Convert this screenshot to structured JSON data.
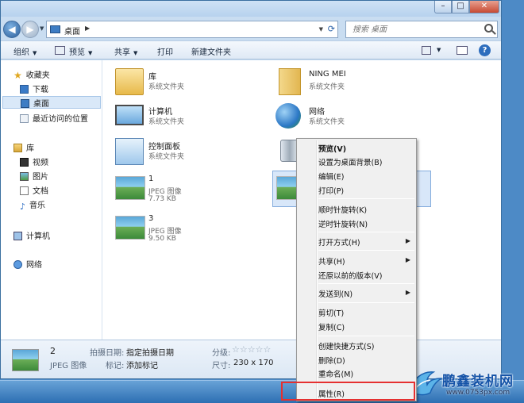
{
  "address": {
    "crumb": "桌面"
  },
  "search": {
    "placeholder": "搜索 桌面"
  },
  "toolbar": {
    "organize": "组织",
    "preview": "预览",
    "share": "共享",
    "print": "打印",
    "new_folder": "新建文件夹"
  },
  "sidebar": {
    "favorites": "收藏夹",
    "downloads": "下载",
    "desktop": "桌面",
    "recent": "最近访问的位置",
    "libraries": "库",
    "videos": "视频",
    "pictures": "图片",
    "documents": "文档",
    "music": "音乐",
    "computer": "计算机",
    "network": "网络"
  },
  "items": [
    {
      "name": "库",
      "desc": "系统文件夹"
    },
    {
      "name": "NING MEI",
      "desc": "系统文件夹"
    },
    {
      "name": "计算机",
      "desc": "系统文件夹"
    },
    {
      "name": "网络",
      "desc": "系统文件夹"
    },
    {
      "name": "控制面板",
      "desc": "系统文件夹"
    },
    {
      "name": "1",
      "desc": "JPEG 图像",
      "size": "7.73 KB"
    },
    {
      "name": "3",
      "desc": "JPEG 图像",
      "size": "9.50 KB"
    }
  ],
  "details": {
    "name": "2",
    "type": "JPEG 图像",
    "date_label": "拍摄日期:",
    "date_value": "指定拍摄日期",
    "tag_label": "标记:",
    "tag_value": "添加标记",
    "rating_label": "分级:",
    "stars": "☆☆☆☆☆",
    "size_label": "尺寸:",
    "size_value": "230 x 170"
  },
  "context_menu": {
    "preview": "预览(V)",
    "set_bg": "设置为桌面背景(B)",
    "edit": "编辑(E)",
    "print": "打印(P)",
    "rotate_cw": "顺时针旋转(K)",
    "rotate_ccw": "逆时针旋转(N)",
    "open_with": "打开方式(H)",
    "share": "共享(H)",
    "restore": "还原以前的版本(V)",
    "send_to": "发送到(N)",
    "cut": "剪切(T)",
    "copy": "复制(C)",
    "shortcut": "创建快捷方式(S)",
    "delete": "删除(D)",
    "rename": "重命名(M)",
    "properties": "属性(R)"
  },
  "watermark": {
    "name": "鹏鑫装机网",
    "url": "www.0753px.com"
  }
}
